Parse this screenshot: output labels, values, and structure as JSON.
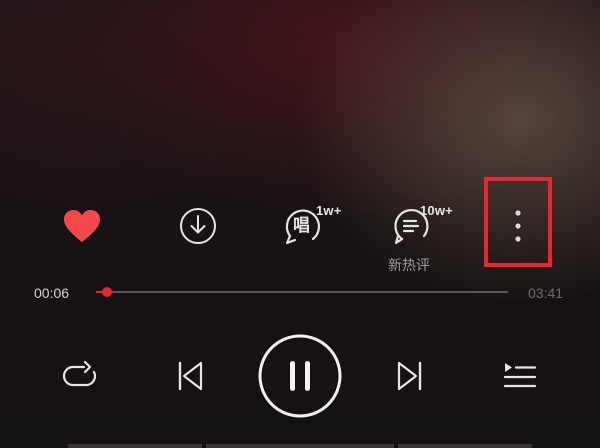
{
  "actions": {
    "like": {
      "icon": "heart-icon",
      "color": "#f2494a"
    },
    "download": {
      "icon": "download-icon"
    },
    "sing": {
      "icon": "sing-icon",
      "glyph": "唱",
      "badge": "1w+"
    },
    "comments": {
      "icon": "comment-icon",
      "badge": "10w+",
      "label": "新热评"
    },
    "more": {
      "icon": "more-vertical-icon"
    }
  },
  "progress": {
    "current_time": "00:06",
    "total_time": "03:41",
    "fraction": 0.027,
    "color": "#e8262d"
  },
  "controls": {
    "repeat": "repeat-icon",
    "previous": "previous-icon",
    "play_pause": "pause-icon",
    "next": "next-icon",
    "playlist": "playlist-icon"
  },
  "highlight_color": "#e8262d"
}
